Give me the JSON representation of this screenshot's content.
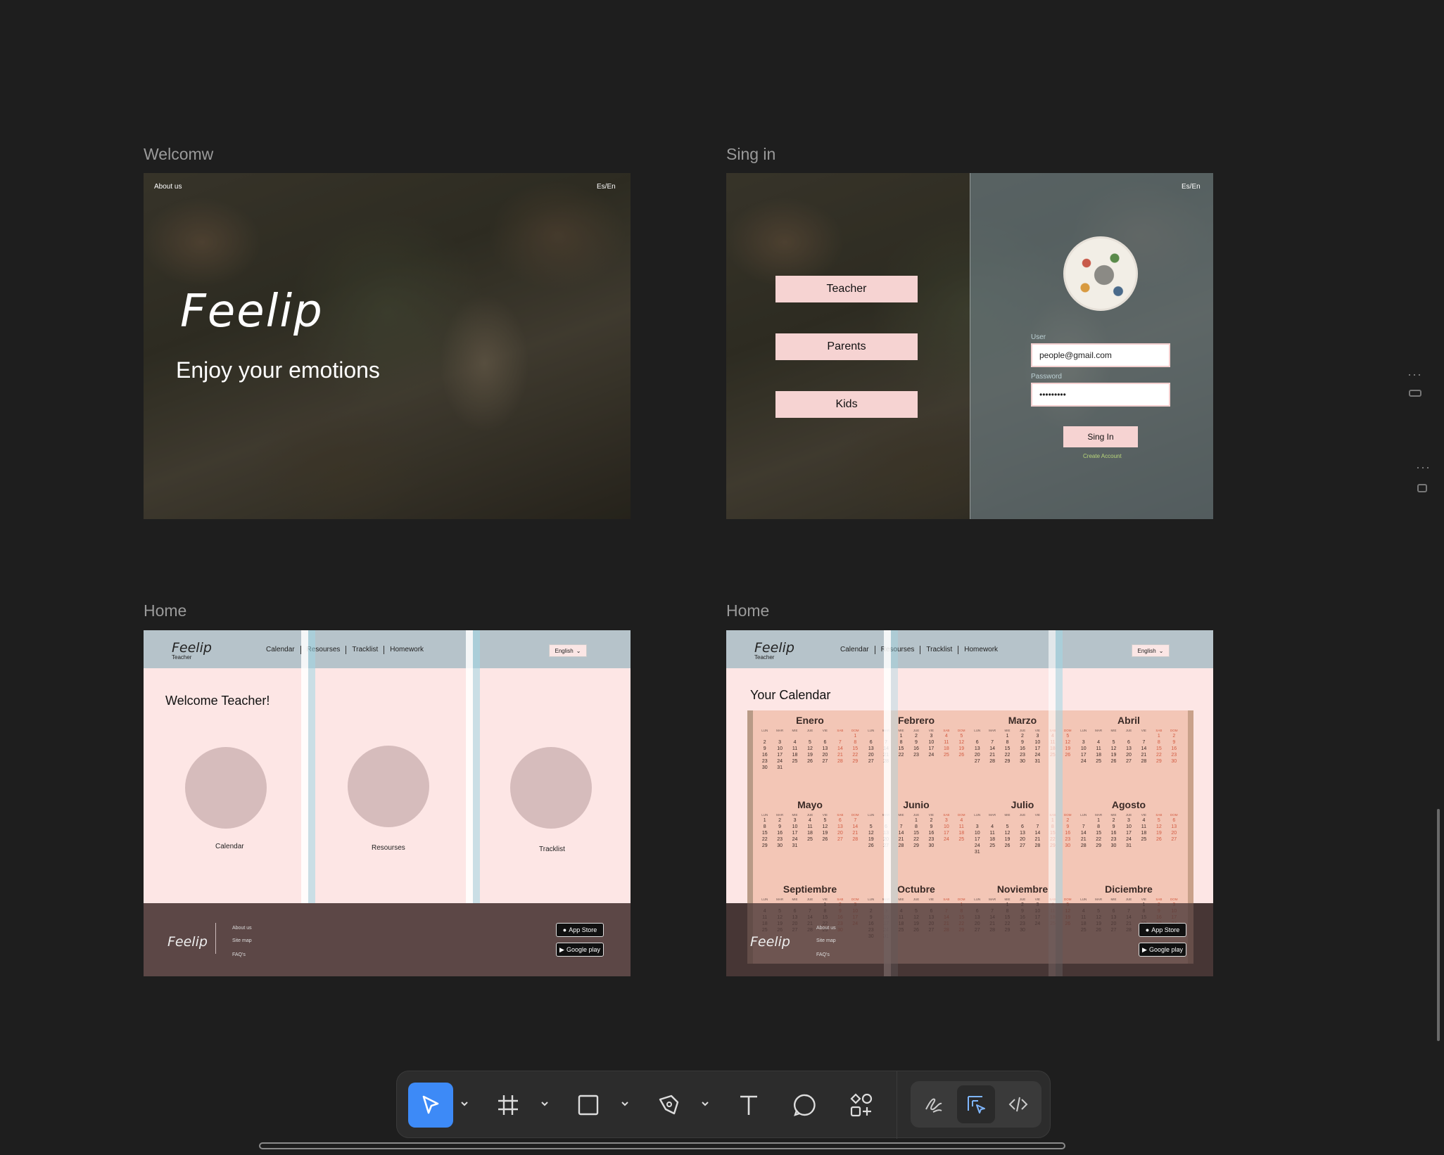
{
  "frames": {
    "welcome": {
      "label": "Welcomw",
      "about": "About us",
      "lang": "Es/En",
      "brand": "Feelip",
      "tagline": "Enjoy your emotions"
    },
    "signin": {
      "label": "Sing in",
      "lang": "Es/En",
      "roles": [
        "Teacher",
        "Parents",
        "Kids"
      ],
      "user_label": "User",
      "user_value": "people@gmail.com",
      "password_label": "Password",
      "password_value": "•••••••••",
      "button": "Sing In",
      "create": "Create Account"
    },
    "home1": {
      "label": "Home",
      "brand": "Feelip",
      "sub": "Teacher",
      "nav": [
        "Calendar",
        "Resourses",
        "Tracklist",
        "Homework"
      ],
      "lang": "English",
      "welcome": "Welcome Teacher!",
      "cards": [
        "Calendar",
        "Resourses",
        "Tracklist"
      ],
      "footer_brand": "Feelip",
      "footer_links": [
        "About us",
        "Site map",
        "FAQ's"
      ],
      "app_store": "App Store",
      "google_play": "Google play"
    },
    "home2": {
      "label": "Home",
      "brand": "Feelip",
      "sub": "Teacher",
      "nav": [
        "Calendar",
        "Resourses",
        "Tracklist",
        "Homework"
      ],
      "lang": "English",
      "title": "Your Calendar",
      "months": [
        "Enero",
        "Febrero",
        "Marzo",
        "Abril",
        "Mayo",
        "Junio",
        "Julio",
        "Agosto",
        "Septiembre",
        "Octubre",
        "Noviembre",
        "Diciembre"
      ],
      "days": [
        "LUN",
        "MAR",
        "MIE",
        "JUE",
        "VIE",
        "SAB",
        "DOM"
      ],
      "footer_brand": "Feelip",
      "footer_links": [
        "About us",
        "Site map",
        "FAQ's"
      ],
      "app_store": "App Store",
      "google_play": "Google play"
    }
  },
  "toolbar": {
    "tools": [
      "move-tool",
      "frame-tool",
      "shape-tool",
      "pen-tool",
      "text-tool",
      "comment-tool",
      "assets-tool"
    ],
    "modes": [
      "draw-mode",
      "design-mode",
      "dev-mode"
    ]
  }
}
